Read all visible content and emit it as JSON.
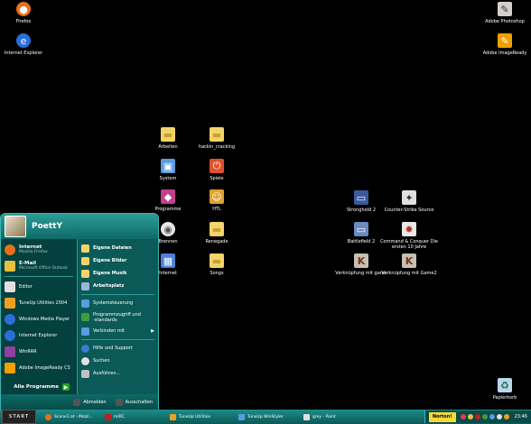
{
  "desktop": {
    "icons": {
      "firefox": {
        "label": "Firefox",
        "color": "#e8701a",
        "glyph": "●"
      },
      "ie": {
        "label": "Internet Explorer",
        "color": "#2a6fd6",
        "glyph": "e"
      },
      "photoshop": {
        "label": "Adobe Photoshop",
        "color": "#d4d0c8",
        "glyph": "✎"
      },
      "imageready": {
        "label": "Adobe ImageReady",
        "color": "#f0a000",
        "glyph": "✎"
      },
      "arbeiten": {
        "label": "Arbeiten",
        "color": "#f3d36b",
        "glyph": "▬"
      },
      "hackin": {
        "label": "hackin_cracking",
        "color": "#f3d36b",
        "glyph": "▬"
      },
      "system": {
        "label": "System",
        "color": "#5b9be0",
        "glyph": "▣"
      },
      "spiele": {
        "label": "Spiele",
        "color": "#e0502a",
        "glyph": "⏻"
      },
      "programme": {
        "label": "Programme",
        "color": "#c04090",
        "glyph": "◆"
      },
      "htl": {
        "label": "HTL",
        "color": "#e0a030",
        "glyph": "☺"
      },
      "brennen": {
        "label": "Brennen",
        "color": "#e8e8e8",
        "glyph": "◉"
      },
      "renegade": {
        "label": "Renegade",
        "color": "#f3d36b",
        "glyph": "▬"
      },
      "internet": {
        "label": "Internet",
        "color": "#4a80d8",
        "glyph": "▦"
      },
      "songs": {
        "label": "Songs",
        "color": "#f3d36b",
        "glyph": "▬"
      },
      "stronghold": {
        "label": "Stronghold 2",
        "color": "#3a5aa0",
        "glyph": "▭"
      },
      "counterstrike": {
        "label": "Counter-Strike Source",
        "color": "#e0e0e0",
        "glyph": "✦"
      },
      "battlefield": {
        "label": "Battlefield 2",
        "color": "#6a8ac0",
        "glyph": "▭"
      },
      "cnc": {
        "label": "Command & Conquer Die ersten 10 Jahre",
        "color": "#e8e8e8",
        "glyph": "✸"
      },
      "vk_game": {
        "label": "Verknüpfung mit game",
        "color": "#c8c0b0",
        "glyph": "K"
      },
      "vk_game2": {
        "label": "Verknüpfung mit Game2",
        "color": "#c8c0b0",
        "glyph": "K"
      },
      "papierkorb": {
        "label": "Papierkorb",
        "color": "#b8d8f0",
        "glyph": "♻"
      }
    }
  },
  "start_menu": {
    "user": "PoettY",
    "left_items": [
      {
        "title": "Internet",
        "subtitle": "Mozilla Firefox",
        "color": "#e8701a"
      },
      {
        "title": "E-Mail",
        "subtitle": "Microsoft Office Outlook",
        "color": "#e8c040"
      },
      {
        "title": "Editor",
        "subtitle": "",
        "color": "#e0e0e0"
      },
      {
        "title": "TuneUp Utilities 2004",
        "subtitle": "",
        "color": "#f0a020"
      },
      {
        "title": "Windows Media Player",
        "subtitle": "",
        "color": "#2a6fd6"
      },
      {
        "title": "Internet Explorer",
        "subtitle": "",
        "color": "#2a6fd6"
      },
      {
        "title": "WinRAR",
        "subtitle": "",
        "color": "#9040a0"
      },
      {
        "title": "Adobe ImageReady CS",
        "subtitle": "",
        "color": "#f0a000"
      }
    ],
    "all_programs": "Alle Programme",
    "right_items": [
      {
        "label": "Eigene Dateien",
        "bold": true,
        "color": "#f3d36b"
      },
      {
        "label": "Eigene Bilder",
        "bold": true,
        "color": "#f3d36b"
      },
      {
        "label": "Eigene Musik",
        "bold": true,
        "color": "#f3d36b"
      },
      {
        "label": "Arbeitsplatz",
        "bold": true,
        "color": "#9ab8d8"
      },
      {
        "label": "Systemsteuerung",
        "bold": false,
        "color": "#5b9be0"
      },
      {
        "label": "Programmzugriff und -standards",
        "bold": false,
        "color": "#3aa03a"
      },
      {
        "label": "Verbinden mit",
        "bold": false,
        "color": "#5b9be0"
      },
      {
        "label": "Hilfe und Support",
        "bold": false,
        "color": "#3a7ad8"
      },
      {
        "label": "Suchen",
        "bold": false,
        "color": "#e0e0e0"
      },
      {
        "label": "Ausführen...",
        "bold": false,
        "color": "#c0c0c0"
      }
    ],
    "footer": {
      "logoff": "Abmelden",
      "shutdown": "Ausschalten"
    }
  },
  "taskbar": {
    "start_label": "START",
    "items": [
      {
        "label": "Scene1.at - Mozil...",
        "color": "#e8701a"
      },
      {
        "label": "mIRC",
        "color": "#c02020"
      },
      {
        "label": "TuneUp Utilities",
        "color": "#f0a020"
      },
      {
        "label": "TuneUp WinStyler",
        "color": "#5b9be0"
      },
      {
        "label": "grey - Paint",
        "color": "#e0e0e0"
      }
    ],
    "norton": "Norton!",
    "clock": "23:46"
  }
}
